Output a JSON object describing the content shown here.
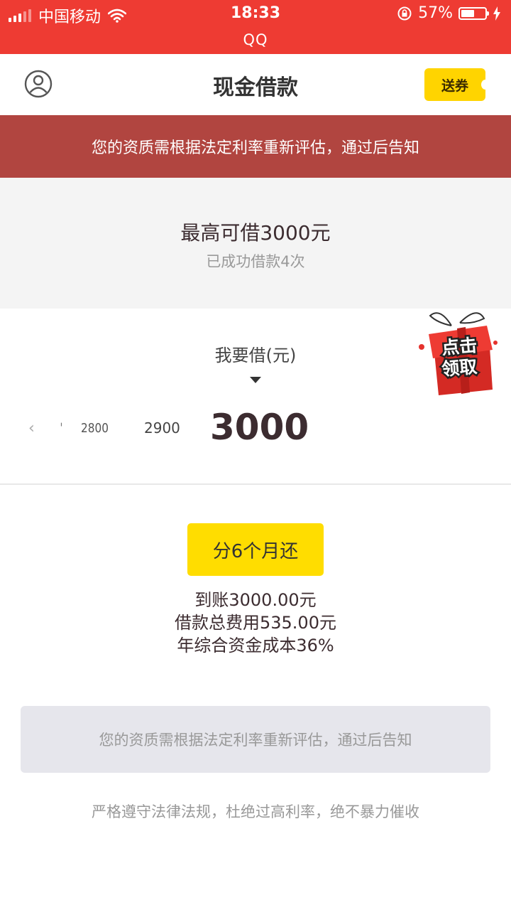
{
  "status_bar": {
    "carrier": "中国移动",
    "time": "18:33",
    "app": "QQ",
    "battery": "57%",
    "battery_level": 0.57
  },
  "nav": {
    "title": "现金借款",
    "coupon_label": "送券",
    "icons": {
      "left": "user-circle-icon"
    }
  },
  "notice_banner": "您的资质需根据法定利率重新评估，通过后告知",
  "limit": {
    "max_label": "最高可借3000元",
    "success_count": "已成功借款4次"
  },
  "gift_badge": {
    "line1": "点击",
    "line2": "领取"
  },
  "amount": {
    "label": "我要借(元)",
    "ruler_chevron": "‹",
    "ruler_tick": "ˈ",
    "ruler_prev2": "2800",
    "ruler_prev1": "2900",
    "selected": "3000"
  },
  "repayment": {
    "term_button": "分6个月还",
    "arrival": "到账3000.00元",
    "total_fee": "借款总费用535.00元",
    "annual_cost": "年综合资金成本36%"
  },
  "info_card": "您的资质需根据法定利率重新评估，通过后告知",
  "compliance": "严格遵守法律法规，杜绝过高利率，绝不暴力催收",
  "colors": {
    "status_red": "#ee3b33",
    "banner_red": "#b14540",
    "accent_yellow": "#ffdd00",
    "text_dark": "#3c2c30"
  }
}
